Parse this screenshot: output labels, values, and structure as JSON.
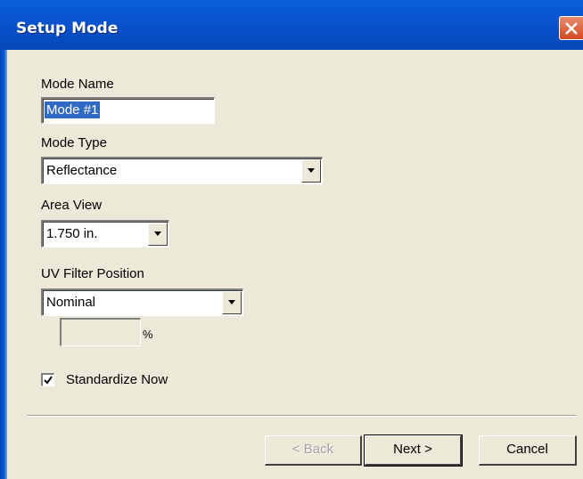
{
  "window": {
    "title": "Setup Mode"
  },
  "mode_name": {
    "label": "Mode Name",
    "value": "Mode #1"
  },
  "mode_type": {
    "label": "Mode Type",
    "value": "Reflectance"
  },
  "area_view": {
    "label": "Area View",
    "value": "1.750 in."
  },
  "uv_filter": {
    "label": "UV Filter Position",
    "value": "Nominal",
    "percent_value": "",
    "percent_unit": "%"
  },
  "standardize": {
    "label": "Standardize Now",
    "checked": true
  },
  "buttons": {
    "back": "< Back",
    "next": "Next >",
    "cancel": "Cancel"
  },
  "colors": {
    "titlebar": "#0a54d0",
    "dialog_bg": "#ece9d8",
    "selection": "#316ac5",
    "close": "#d14a22"
  }
}
